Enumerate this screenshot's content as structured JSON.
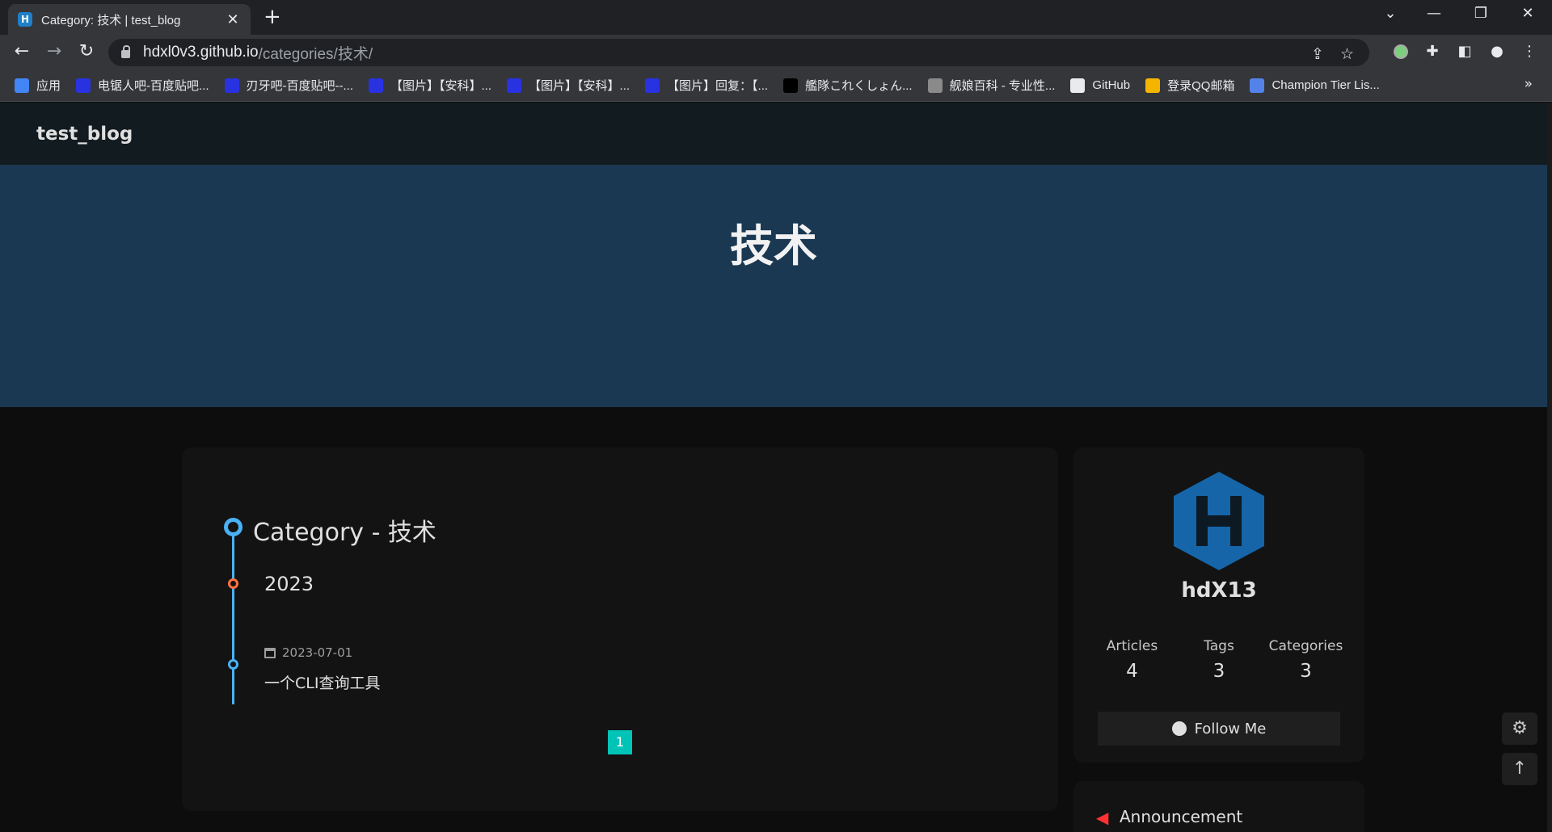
{
  "browser": {
    "tab_title": "Category: 技术 | test_blog",
    "tab_favicon": "H",
    "new_tab": "+",
    "url_host": "hdxl0v3.github.io",
    "url_path": "/categories/技术/",
    "bookmarks": [
      {
        "label": "应用",
        "icon": "apps-grid-icon",
        "color": "#4285f4"
      },
      {
        "label": "电锯人吧-百度贴吧...",
        "icon": "baidu-paw-icon",
        "color": "#2932e1"
      },
      {
        "label": "刃牙吧-百度贴吧--...",
        "icon": "baidu-paw-icon",
        "color": "#2932e1"
      },
      {
        "label": "【图片】【安科】...",
        "icon": "baidu-paw-icon",
        "color": "#2932e1"
      },
      {
        "label": "【图片】【安科】...",
        "icon": "baidu-paw-icon",
        "color": "#2932e1"
      },
      {
        "label": "【图片】回复：【...",
        "icon": "baidu-paw-icon",
        "color": "#2932e1"
      },
      {
        "label": "艦隊これくしょん...",
        "icon": "dmm-icon",
        "color": "#000000"
      },
      {
        "label": "舰娘百科 - 专业性...",
        "icon": "wiki-icon",
        "color": "#8a8a8a"
      },
      {
        "label": "GitHub",
        "icon": "github-icon",
        "color": "#e8eaed"
      },
      {
        "label": "登录QQ邮箱",
        "icon": "qq-mail-icon",
        "color": "#f4b400"
      },
      {
        "label": "Champion Tier Lis...",
        "icon": "opgg-icon",
        "color": "#5383e8"
      }
    ],
    "bookmarks_more": "»"
  },
  "site": {
    "name": "test_blog",
    "hero_title": "技术"
  },
  "timeline": {
    "heading": "Category - 技术",
    "year": "2023",
    "posts": [
      {
        "date": "2023-07-01",
        "title": "一个CLI查询工具"
      }
    ],
    "current_page": "1"
  },
  "author": {
    "avatar_letter": "H",
    "avatar_color": "#1565a8",
    "name": "hdX13",
    "stats": [
      {
        "label": "Articles",
        "value": "4"
      },
      {
        "label": "Tags",
        "value": "3"
      },
      {
        "label": "Categories",
        "value": "3"
      }
    ],
    "follow_label": "Follow Me"
  },
  "announcement": {
    "title": "Announcement",
    "icon_color": "#ff3232"
  },
  "colors": {
    "accent": "#49b1f5",
    "year_dot": "#ff7242",
    "pagination": "#00c4b6",
    "hero_bg": "#1a3851"
  }
}
